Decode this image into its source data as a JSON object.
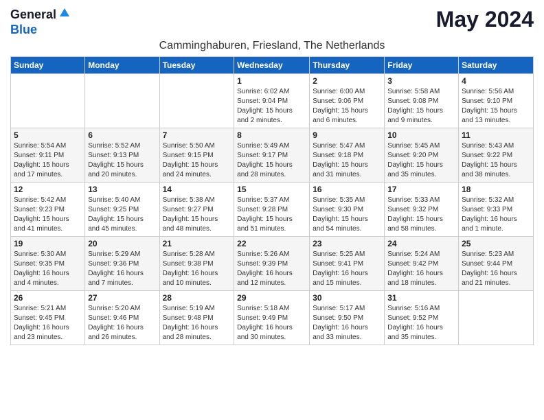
{
  "header": {
    "logo_general": "General",
    "logo_blue": "Blue",
    "month_year": "May 2024",
    "location": "Camminghaburen, Friesland, The Netherlands"
  },
  "weekdays": [
    "Sunday",
    "Monday",
    "Tuesday",
    "Wednesday",
    "Thursday",
    "Friday",
    "Saturday"
  ],
  "weeks": [
    [
      {
        "day": "",
        "info": ""
      },
      {
        "day": "",
        "info": ""
      },
      {
        "day": "",
        "info": ""
      },
      {
        "day": "1",
        "info": "Sunrise: 6:02 AM\nSunset: 9:04 PM\nDaylight: 15 hours\nand 2 minutes."
      },
      {
        "day": "2",
        "info": "Sunrise: 6:00 AM\nSunset: 9:06 PM\nDaylight: 15 hours\nand 6 minutes."
      },
      {
        "day": "3",
        "info": "Sunrise: 5:58 AM\nSunset: 9:08 PM\nDaylight: 15 hours\nand 9 minutes."
      },
      {
        "day": "4",
        "info": "Sunrise: 5:56 AM\nSunset: 9:10 PM\nDaylight: 15 hours\nand 13 minutes."
      }
    ],
    [
      {
        "day": "5",
        "info": "Sunrise: 5:54 AM\nSunset: 9:11 PM\nDaylight: 15 hours\nand 17 minutes."
      },
      {
        "day": "6",
        "info": "Sunrise: 5:52 AM\nSunset: 9:13 PM\nDaylight: 15 hours\nand 20 minutes."
      },
      {
        "day": "7",
        "info": "Sunrise: 5:50 AM\nSunset: 9:15 PM\nDaylight: 15 hours\nand 24 minutes."
      },
      {
        "day": "8",
        "info": "Sunrise: 5:49 AM\nSunset: 9:17 PM\nDaylight: 15 hours\nand 28 minutes."
      },
      {
        "day": "9",
        "info": "Sunrise: 5:47 AM\nSunset: 9:18 PM\nDaylight: 15 hours\nand 31 minutes."
      },
      {
        "day": "10",
        "info": "Sunrise: 5:45 AM\nSunset: 9:20 PM\nDaylight: 15 hours\nand 35 minutes."
      },
      {
        "day": "11",
        "info": "Sunrise: 5:43 AM\nSunset: 9:22 PM\nDaylight: 15 hours\nand 38 minutes."
      }
    ],
    [
      {
        "day": "12",
        "info": "Sunrise: 5:42 AM\nSunset: 9:23 PM\nDaylight: 15 hours\nand 41 minutes."
      },
      {
        "day": "13",
        "info": "Sunrise: 5:40 AM\nSunset: 9:25 PM\nDaylight: 15 hours\nand 45 minutes."
      },
      {
        "day": "14",
        "info": "Sunrise: 5:38 AM\nSunset: 9:27 PM\nDaylight: 15 hours\nand 48 minutes."
      },
      {
        "day": "15",
        "info": "Sunrise: 5:37 AM\nSunset: 9:28 PM\nDaylight: 15 hours\nand 51 minutes."
      },
      {
        "day": "16",
        "info": "Sunrise: 5:35 AM\nSunset: 9:30 PM\nDaylight: 15 hours\nand 54 minutes."
      },
      {
        "day": "17",
        "info": "Sunrise: 5:33 AM\nSunset: 9:32 PM\nDaylight: 15 hours\nand 58 minutes."
      },
      {
        "day": "18",
        "info": "Sunrise: 5:32 AM\nSunset: 9:33 PM\nDaylight: 16 hours\nand 1 minute."
      }
    ],
    [
      {
        "day": "19",
        "info": "Sunrise: 5:30 AM\nSunset: 9:35 PM\nDaylight: 16 hours\nand 4 minutes."
      },
      {
        "day": "20",
        "info": "Sunrise: 5:29 AM\nSunset: 9:36 PM\nDaylight: 16 hours\nand 7 minutes."
      },
      {
        "day": "21",
        "info": "Sunrise: 5:28 AM\nSunset: 9:38 PM\nDaylight: 16 hours\nand 10 minutes."
      },
      {
        "day": "22",
        "info": "Sunrise: 5:26 AM\nSunset: 9:39 PM\nDaylight: 16 hours\nand 12 minutes."
      },
      {
        "day": "23",
        "info": "Sunrise: 5:25 AM\nSunset: 9:41 PM\nDaylight: 16 hours\nand 15 minutes."
      },
      {
        "day": "24",
        "info": "Sunrise: 5:24 AM\nSunset: 9:42 PM\nDaylight: 16 hours\nand 18 minutes."
      },
      {
        "day": "25",
        "info": "Sunrise: 5:23 AM\nSunset: 9:44 PM\nDaylight: 16 hours\nand 21 minutes."
      }
    ],
    [
      {
        "day": "26",
        "info": "Sunrise: 5:21 AM\nSunset: 9:45 PM\nDaylight: 16 hours\nand 23 minutes."
      },
      {
        "day": "27",
        "info": "Sunrise: 5:20 AM\nSunset: 9:46 PM\nDaylight: 16 hours\nand 26 minutes."
      },
      {
        "day": "28",
        "info": "Sunrise: 5:19 AM\nSunset: 9:48 PM\nDaylight: 16 hours\nand 28 minutes."
      },
      {
        "day": "29",
        "info": "Sunrise: 5:18 AM\nSunset: 9:49 PM\nDaylight: 16 hours\nand 30 minutes."
      },
      {
        "day": "30",
        "info": "Sunrise: 5:17 AM\nSunset: 9:50 PM\nDaylight: 16 hours\nand 33 minutes."
      },
      {
        "day": "31",
        "info": "Sunrise: 5:16 AM\nSunset: 9:52 PM\nDaylight: 16 hours\nand 35 minutes."
      },
      {
        "day": "",
        "info": ""
      }
    ]
  ]
}
